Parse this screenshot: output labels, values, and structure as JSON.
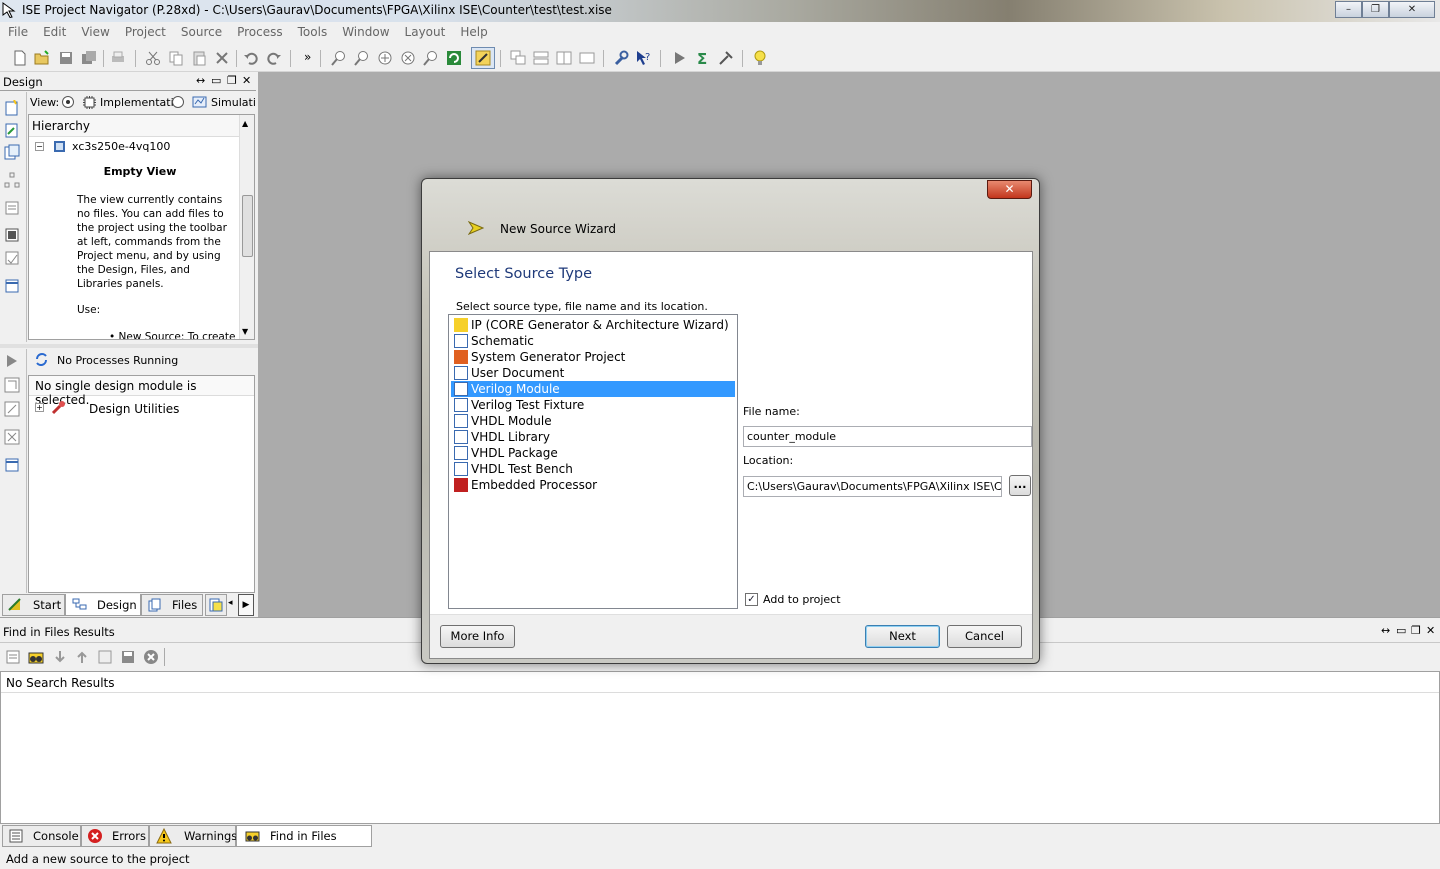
{
  "window": {
    "title": "ISE Project Navigator (P.28xd) - C:\\Users\\Gaurav\\Documents\\FPGA\\Xilinx ISE\\Counter\\test\\test.xise",
    "controls": [
      "–",
      "❐",
      "✕"
    ]
  },
  "menu": [
    "File",
    "Edit",
    "View",
    "Project",
    "Source",
    "Process",
    "Tools",
    "Window",
    "Layout",
    "Help"
  ],
  "design_panel": {
    "title": "Design",
    "view_label": "View:",
    "view_options": [
      "Implementation",
      "Simulation"
    ],
    "hierarchy_label": "Hierarchy",
    "device": "xc3s250e-4vq100",
    "empty_title": "Empty View",
    "empty_text": "The view currently contains no files. You can add files to the project using the toolbar at left, commands from the Project menu, and by using the Design, Files, and Libraries panels.",
    "use_label": "Use:",
    "bullet": "New Source: To create",
    "processes_status": "No Processes Running",
    "no_module": "No single design module is selected.",
    "utilities": "Design Utilities",
    "tabs": [
      "Start",
      "Design",
      "Files"
    ]
  },
  "find_panel": {
    "title": "Find in Files Results",
    "result": "No Search Results",
    "tabs": [
      "Console",
      "Errors",
      "Warnings",
      "Find in Files Results"
    ]
  },
  "status_bar": "Add a new source to the project",
  "dialog": {
    "title": "New Source Wizard",
    "heading": "Select Source Type",
    "instruction": "Select source type, file name and its location.",
    "source_types": [
      "IP (CORE Generator & Architecture Wizard)",
      "Schematic",
      "System Generator Project",
      "User Document",
      "Verilog Module",
      "Verilog Test Fixture",
      "VHDL Module",
      "VHDL Library",
      "VHDL Package",
      "VHDL Test Bench",
      "Embedded Processor"
    ],
    "selected_index": 4,
    "file_name_label": "File name:",
    "file_name_value": "counter_module",
    "location_label": "Location:",
    "location_value": "C:\\Users\\Gaurav\\Documents\\FPGA\\Xilinx ISE\\Counter",
    "browse_label": "...",
    "add_to_project_label": "Add to project",
    "add_to_project_checked": true,
    "more_info": "More Info",
    "next": "Next",
    "cancel": "Cancel"
  }
}
